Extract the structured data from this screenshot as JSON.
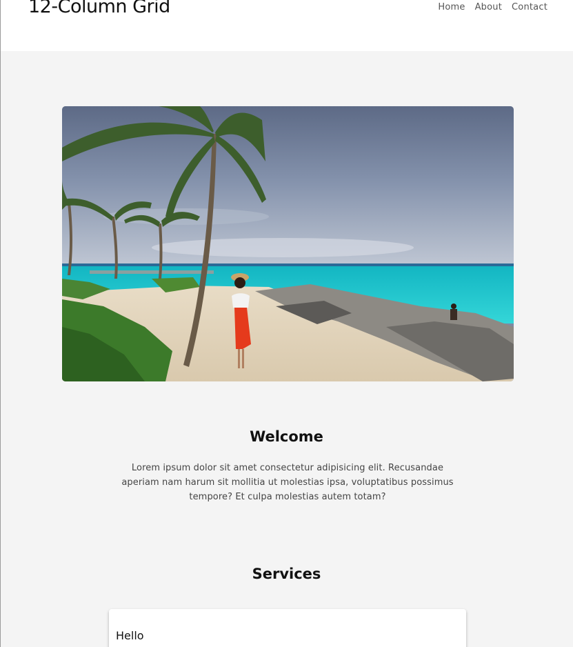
{
  "header": {
    "brand": "12-Column Grid",
    "nav": [
      {
        "label": "Home"
      },
      {
        "label": "About"
      },
      {
        "label": "Contact"
      }
    ]
  },
  "hero": {
    "image": "beach-palm-photo"
  },
  "welcome": {
    "title": "Welcome",
    "text": "Lorem ipsum dolor sit amet consectetur adipisicing elit. Recusandae aperiam nam harum sit mollitia ut molestias ipsa, voluptatibus possimus tempore? Et culpa molestias autem totam?"
  },
  "services": {
    "title": "Services",
    "cards": [
      {
        "title": "Hello"
      }
    ]
  },
  "colors": {
    "page_background": "#f4f4f4",
    "header_background": "#ffffff",
    "card_background": "#ffffff"
  }
}
